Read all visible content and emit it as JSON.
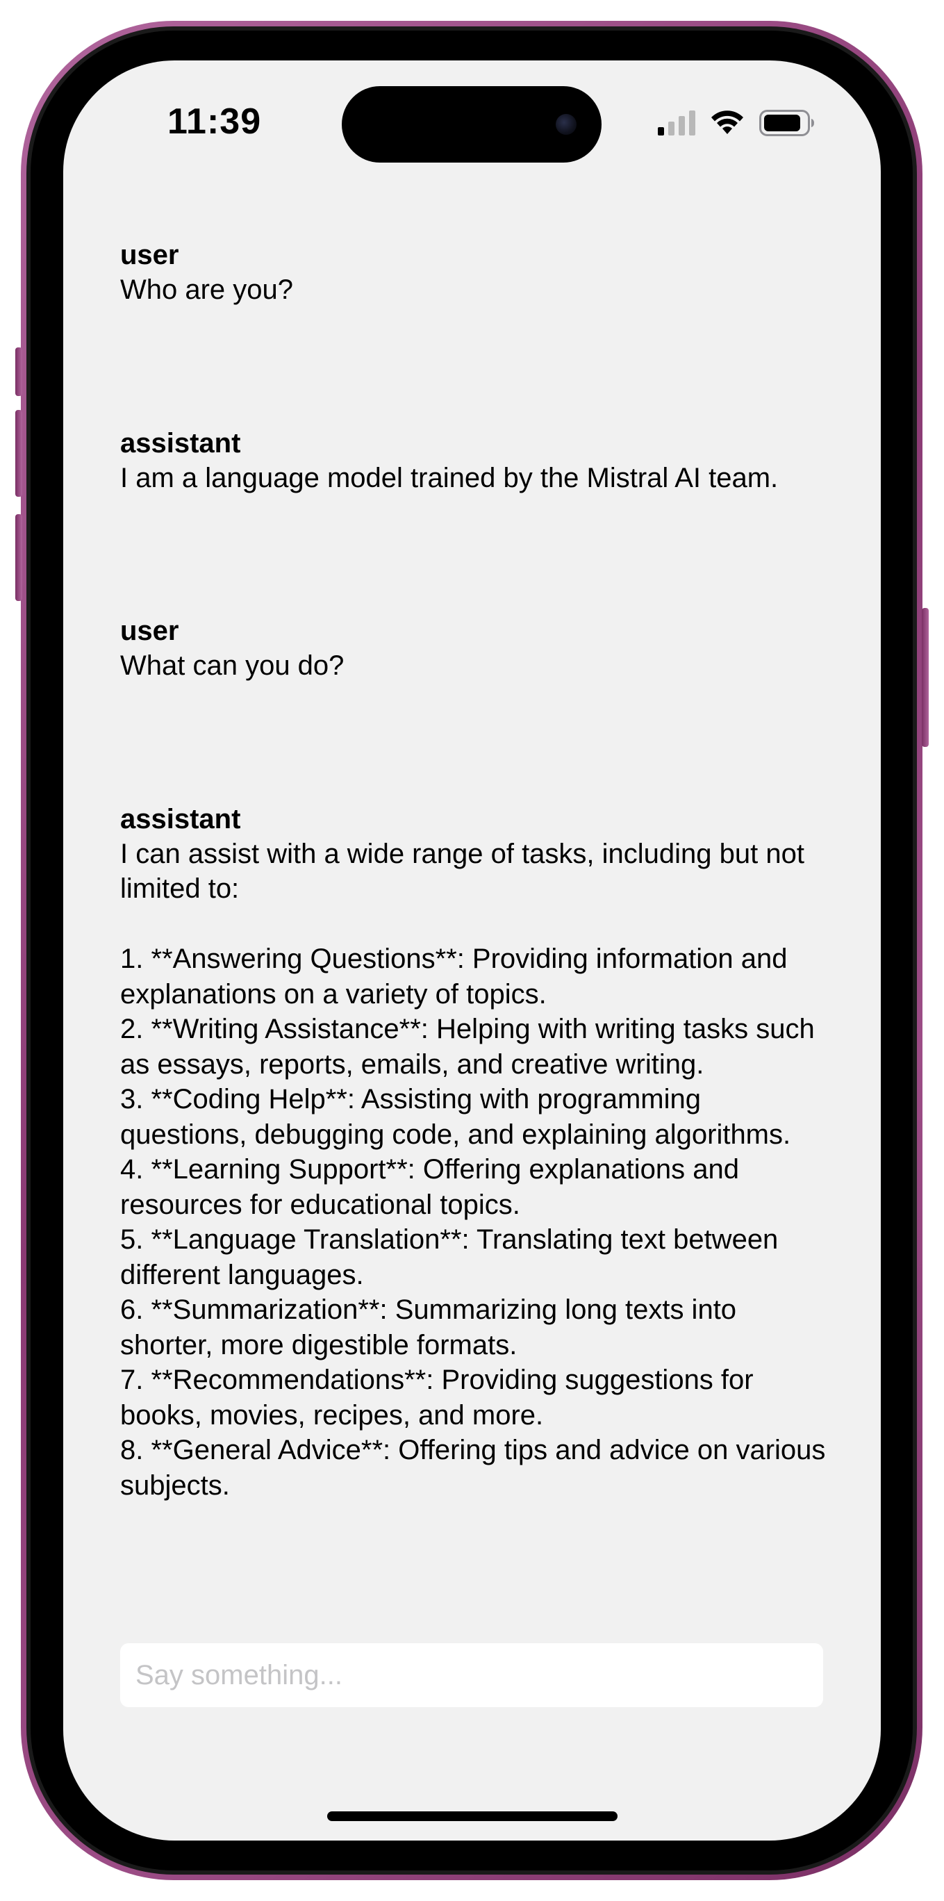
{
  "status_bar": {
    "time": "11:39",
    "icons": [
      "cellular-signal-icon",
      "wifi-icon",
      "battery-icon"
    ]
  },
  "messages": [
    {
      "role": "user",
      "text": "Who are you?"
    },
    {
      "role": "assistant",
      "text": "I am a language model trained by the Mistral AI team."
    },
    {
      "role": "user",
      "text": "What can you do?"
    },
    {
      "role": "assistant",
      "text": "I can assist with a wide range of tasks, including but not limited to:\n\n1. **Answering Questions**: Providing information and explanations on a variety of topics.\n2. **Writing Assistance**: Helping with writing tasks such as essays, reports, emails, and creative writing.\n3. **Coding Help**: Assisting with programming questions, debugging code, and explaining algorithms.\n4. **Learning Support**: Offering explanations and resources for educational topics.\n5. **Language Translation**: Translating text between different languages.\n6. **Summarization**: Summarizing long texts into shorter, more digestible formats.\n7. **Recommendations**: Providing suggestions for books, movies, recipes, and more.\n8. **General Advice**: Offering tips and advice on various subjects."
    }
  ],
  "composer": {
    "placeholder": "Say something..."
  },
  "colors": {
    "screen_background": "#f1f1f1",
    "frame": "#9c4d86",
    "placeholder": "#c4c4c6"
  }
}
